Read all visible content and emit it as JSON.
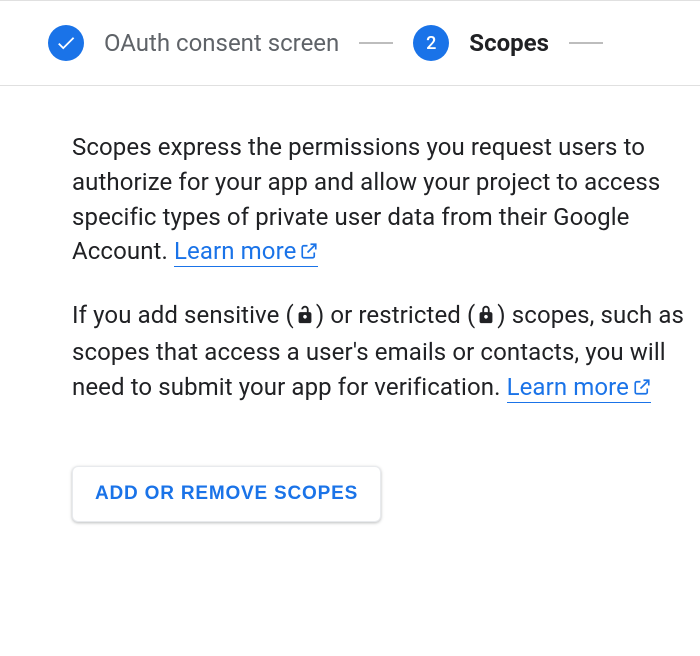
{
  "stepper": {
    "steps": [
      {
        "label": "OAuth consent screen",
        "completed": true
      },
      {
        "label": "Scopes",
        "number": "2",
        "active": true
      }
    ]
  },
  "content": {
    "p1a": "Scopes express the permissions you request users to authorize for your app and allow your project to access specific types of private user data from their Google Account. ",
    "learn1": "Learn more",
    "p2a": "If you add sensitive (",
    "p2b": ") or restricted (",
    "p2c": ") scopes, such as scopes that access a user's emails or contacts, you will need to submit your app for verification. ",
    "learn2": "Learn more",
    "button": "ADD OR REMOVE SCOPES"
  }
}
